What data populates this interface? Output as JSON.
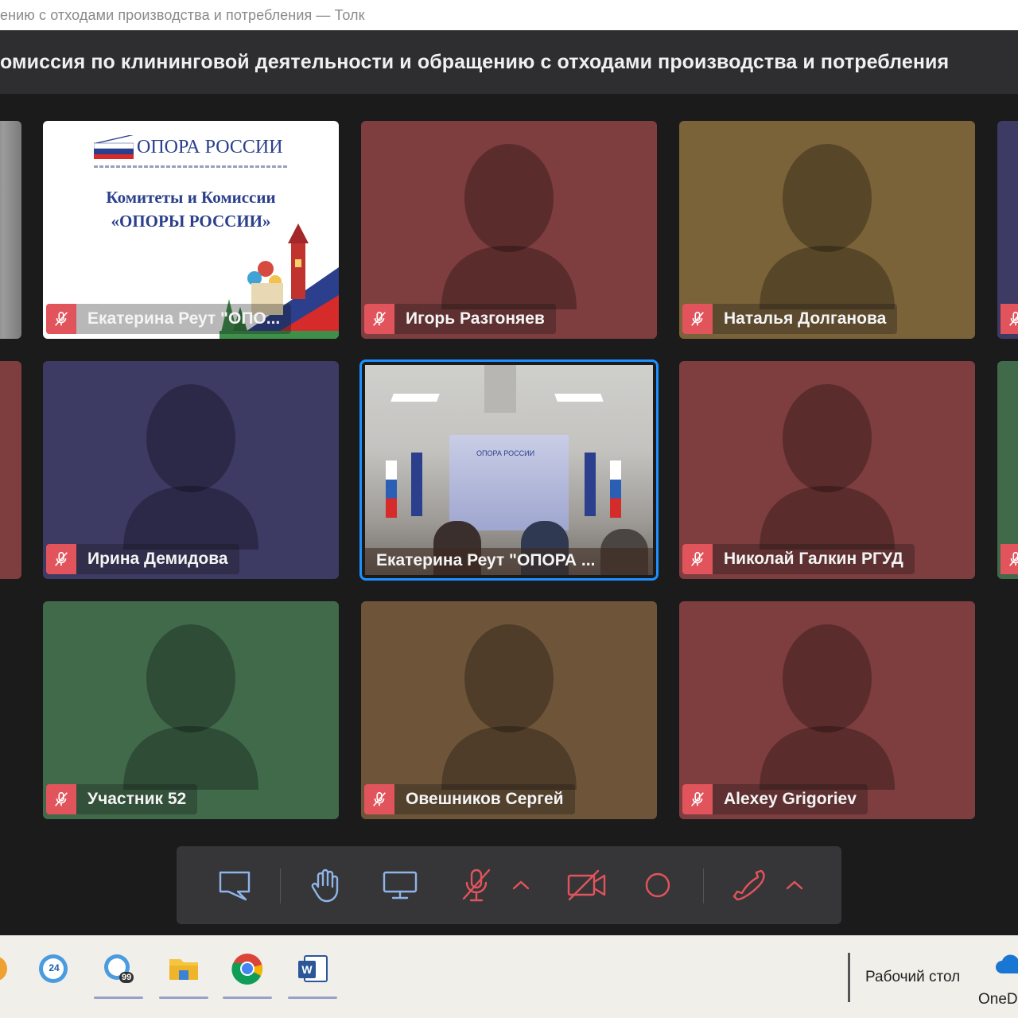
{
  "window": {
    "title": "ению с отходами производства и потребления — Толк"
  },
  "meeting": {
    "title": "омиссия по клининговой деятельности и обращению с отходами производства и потребления"
  },
  "slide": {
    "logo_text": "ОПОРА РОССИИ",
    "line1": "Комитеты и Комиссии",
    "line2": "«ОПОРЫ РОССИИ»"
  },
  "room": {
    "backdrop_logo": "ОПОРА РОССИИ"
  },
  "participants": [
    {
      "name": "Екатерина Реут \"ОПО...",
      "muted": true,
      "color": "#ffffff",
      "kind": "slide"
    },
    {
      "name": "Игорь Разгоняев",
      "muted": true,
      "color": "#7e3d3e"
    },
    {
      "name": "Наталья Долганова",
      "muted": true,
      "color": "#7a6239"
    },
    {
      "name": "Ирина Демидова",
      "muted": true,
      "color": "#3d3a64"
    },
    {
      "name": "Екатерина Реут \"ОПОРА ...",
      "muted": false,
      "color": "#c9c7c4",
      "kind": "video",
      "active_speaker": true
    },
    {
      "name": "Николай Галкин РГУД",
      "muted": true,
      "color": "#7e3d3e"
    },
    {
      "name": "Участник 52",
      "muted": true,
      "color": "#416a4b"
    },
    {
      "name": "Овешников Сергей",
      "muted": true,
      "color": "#6e5539"
    },
    {
      "name": "Alexey Grigoriev",
      "muted": true,
      "color": "#7e3d3e"
    }
  ],
  "edge_tiles": {
    "left_colors": [
      "#8a8a8a",
      "#7e3d3e"
    ],
    "right_colors": [
      "#3d3a64",
      "#7e3d3e",
      "#416a4b"
    ]
  },
  "toolbar": {
    "icons": [
      "chat-icon",
      "raise-hand-icon",
      "screen-share-icon",
      "mic-off-icon",
      "chevron-up-icon",
      "camera-off-icon",
      "record-icon",
      "hang-up-icon",
      "chevron-up-icon"
    ],
    "accent_color": "#e2545c",
    "icon_color": "#8fb4e8"
  },
  "taskbar": {
    "badge_24": "24",
    "badge_99": "99",
    "desktop_label": "Рабочий стол",
    "onedrive_label": "OneD"
  }
}
